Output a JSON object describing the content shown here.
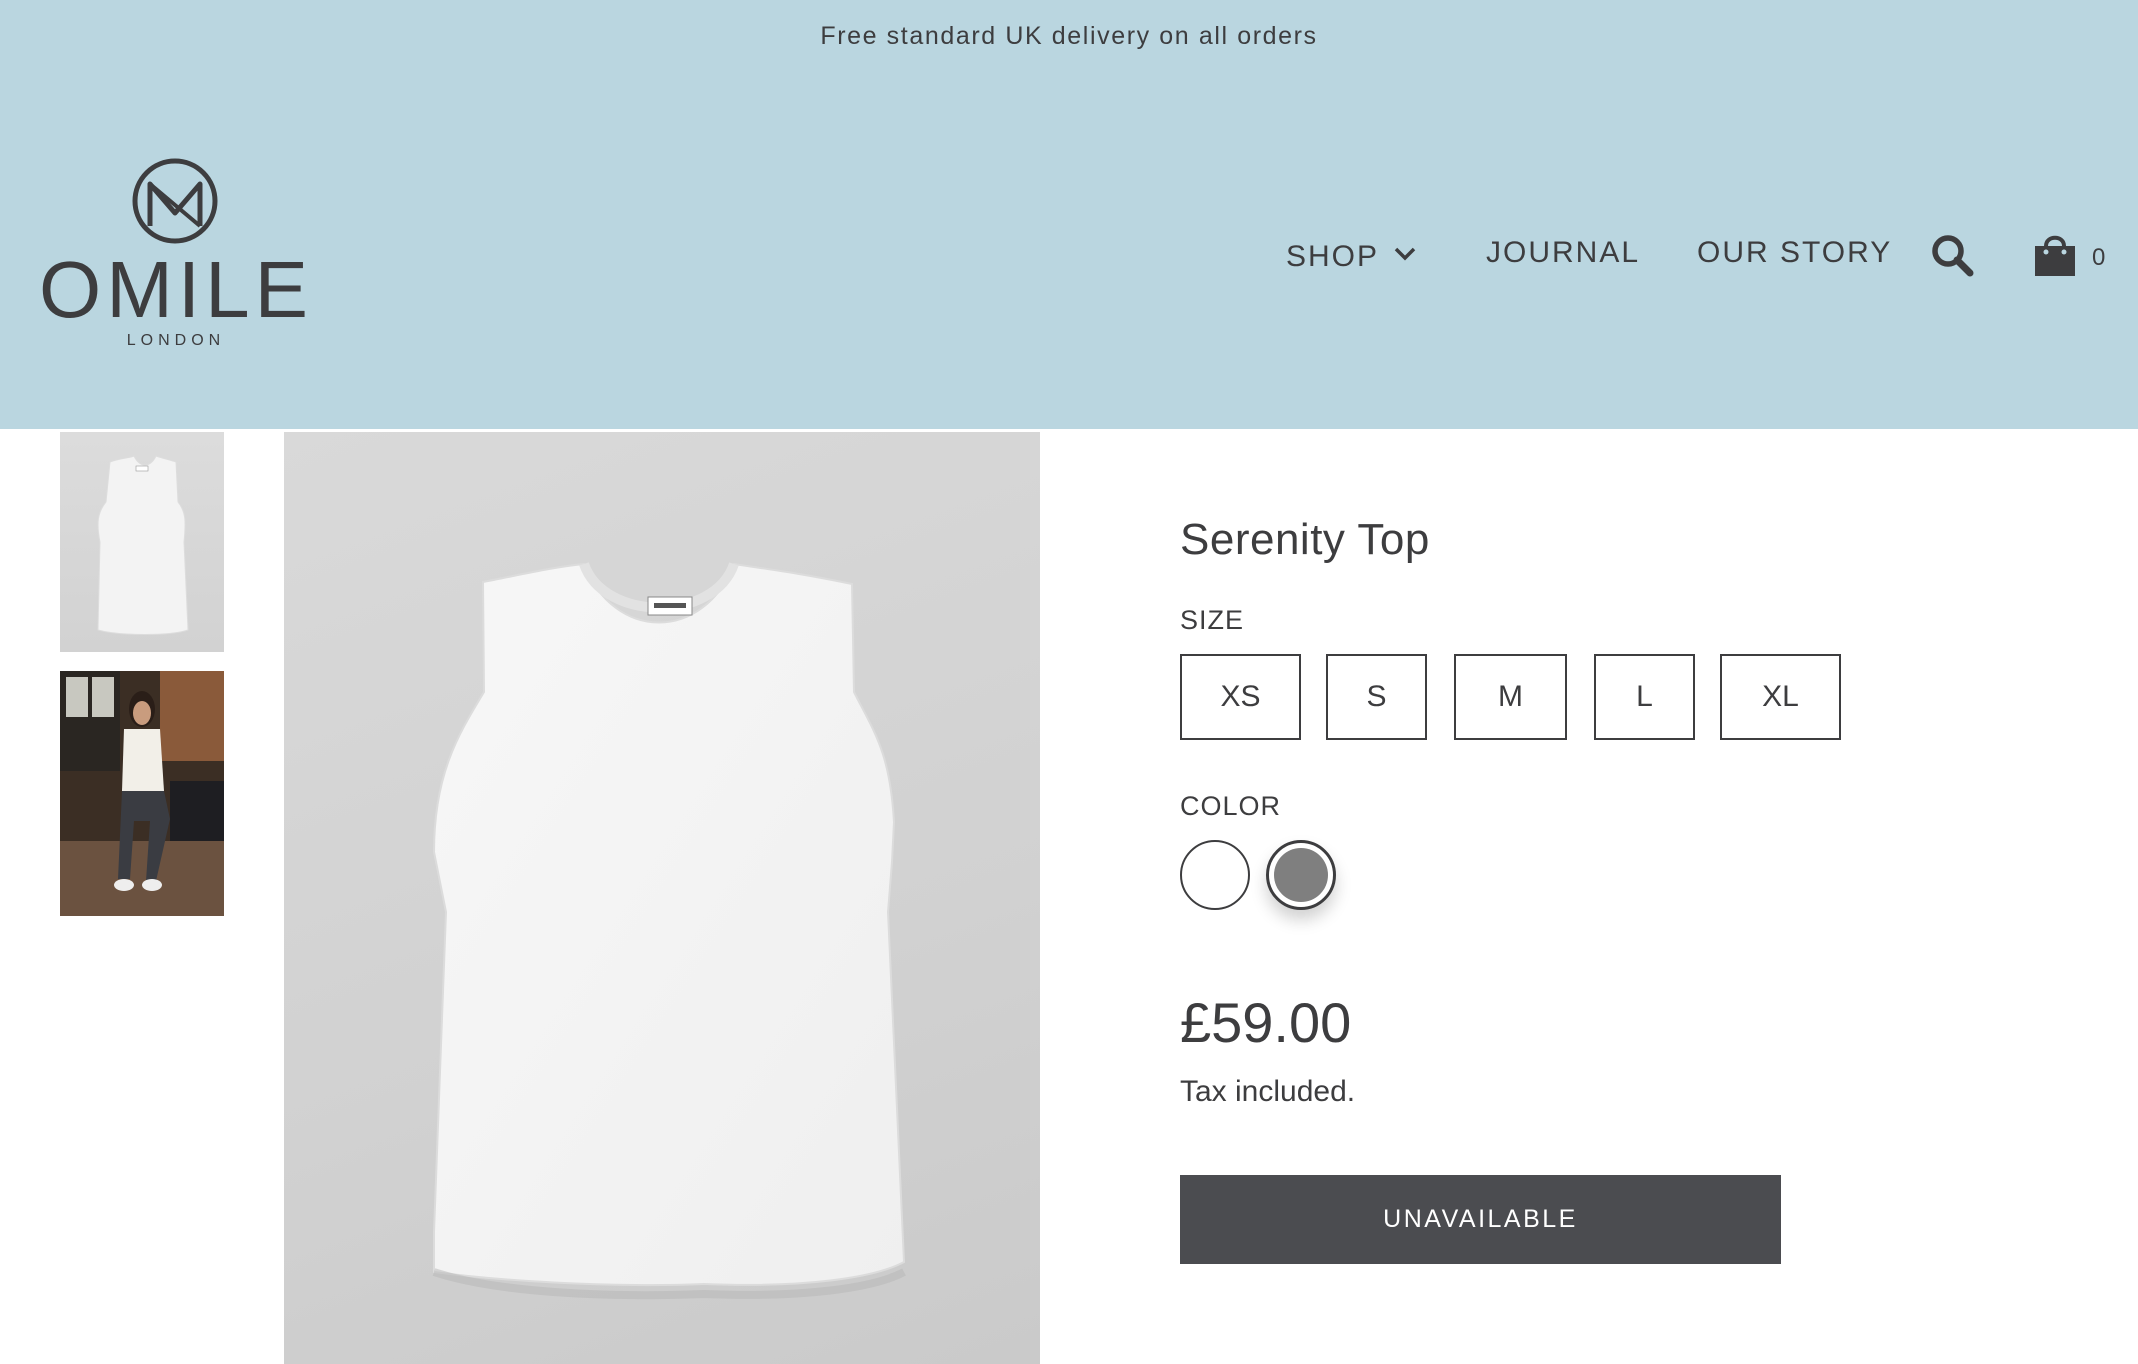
{
  "announcement": "Free standard UK delivery on all orders",
  "brand": {
    "name": "OMILE",
    "subtitle": "LONDON"
  },
  "nav": {
    "shop": "SHOP",
    "journal": "JOURNAL",
    "our_story": "OUR STORY",
    "search_icon": "search-icon",
    "cart_icon": "shopping-bag-icon",
    "cart_count": "0"
  },
  "product": {
    "title": "Serenity Top",
    "size_label": "SIZE",
    "sizes": [
      "XS",
      "S",
      "M",
      "L",
      "XL"
    ],
    "color_label": "COLOR",
    "colors": [
      {
        "name": "white",
        "hex": "#ffffff"
      },
      {
        "name": "grey",
        "hex": "#7f7f7f"
      }
    ],
    "price": "£59.00",
    "tax_note": "Tax included.",
    "button_label": "UNAVAILABLE"
  },
  "colors": {
    "header_bg": "#bad6e0",
    "text": "#3d3d3f",
    "button_bg": "#4b4c50"
  }
}
